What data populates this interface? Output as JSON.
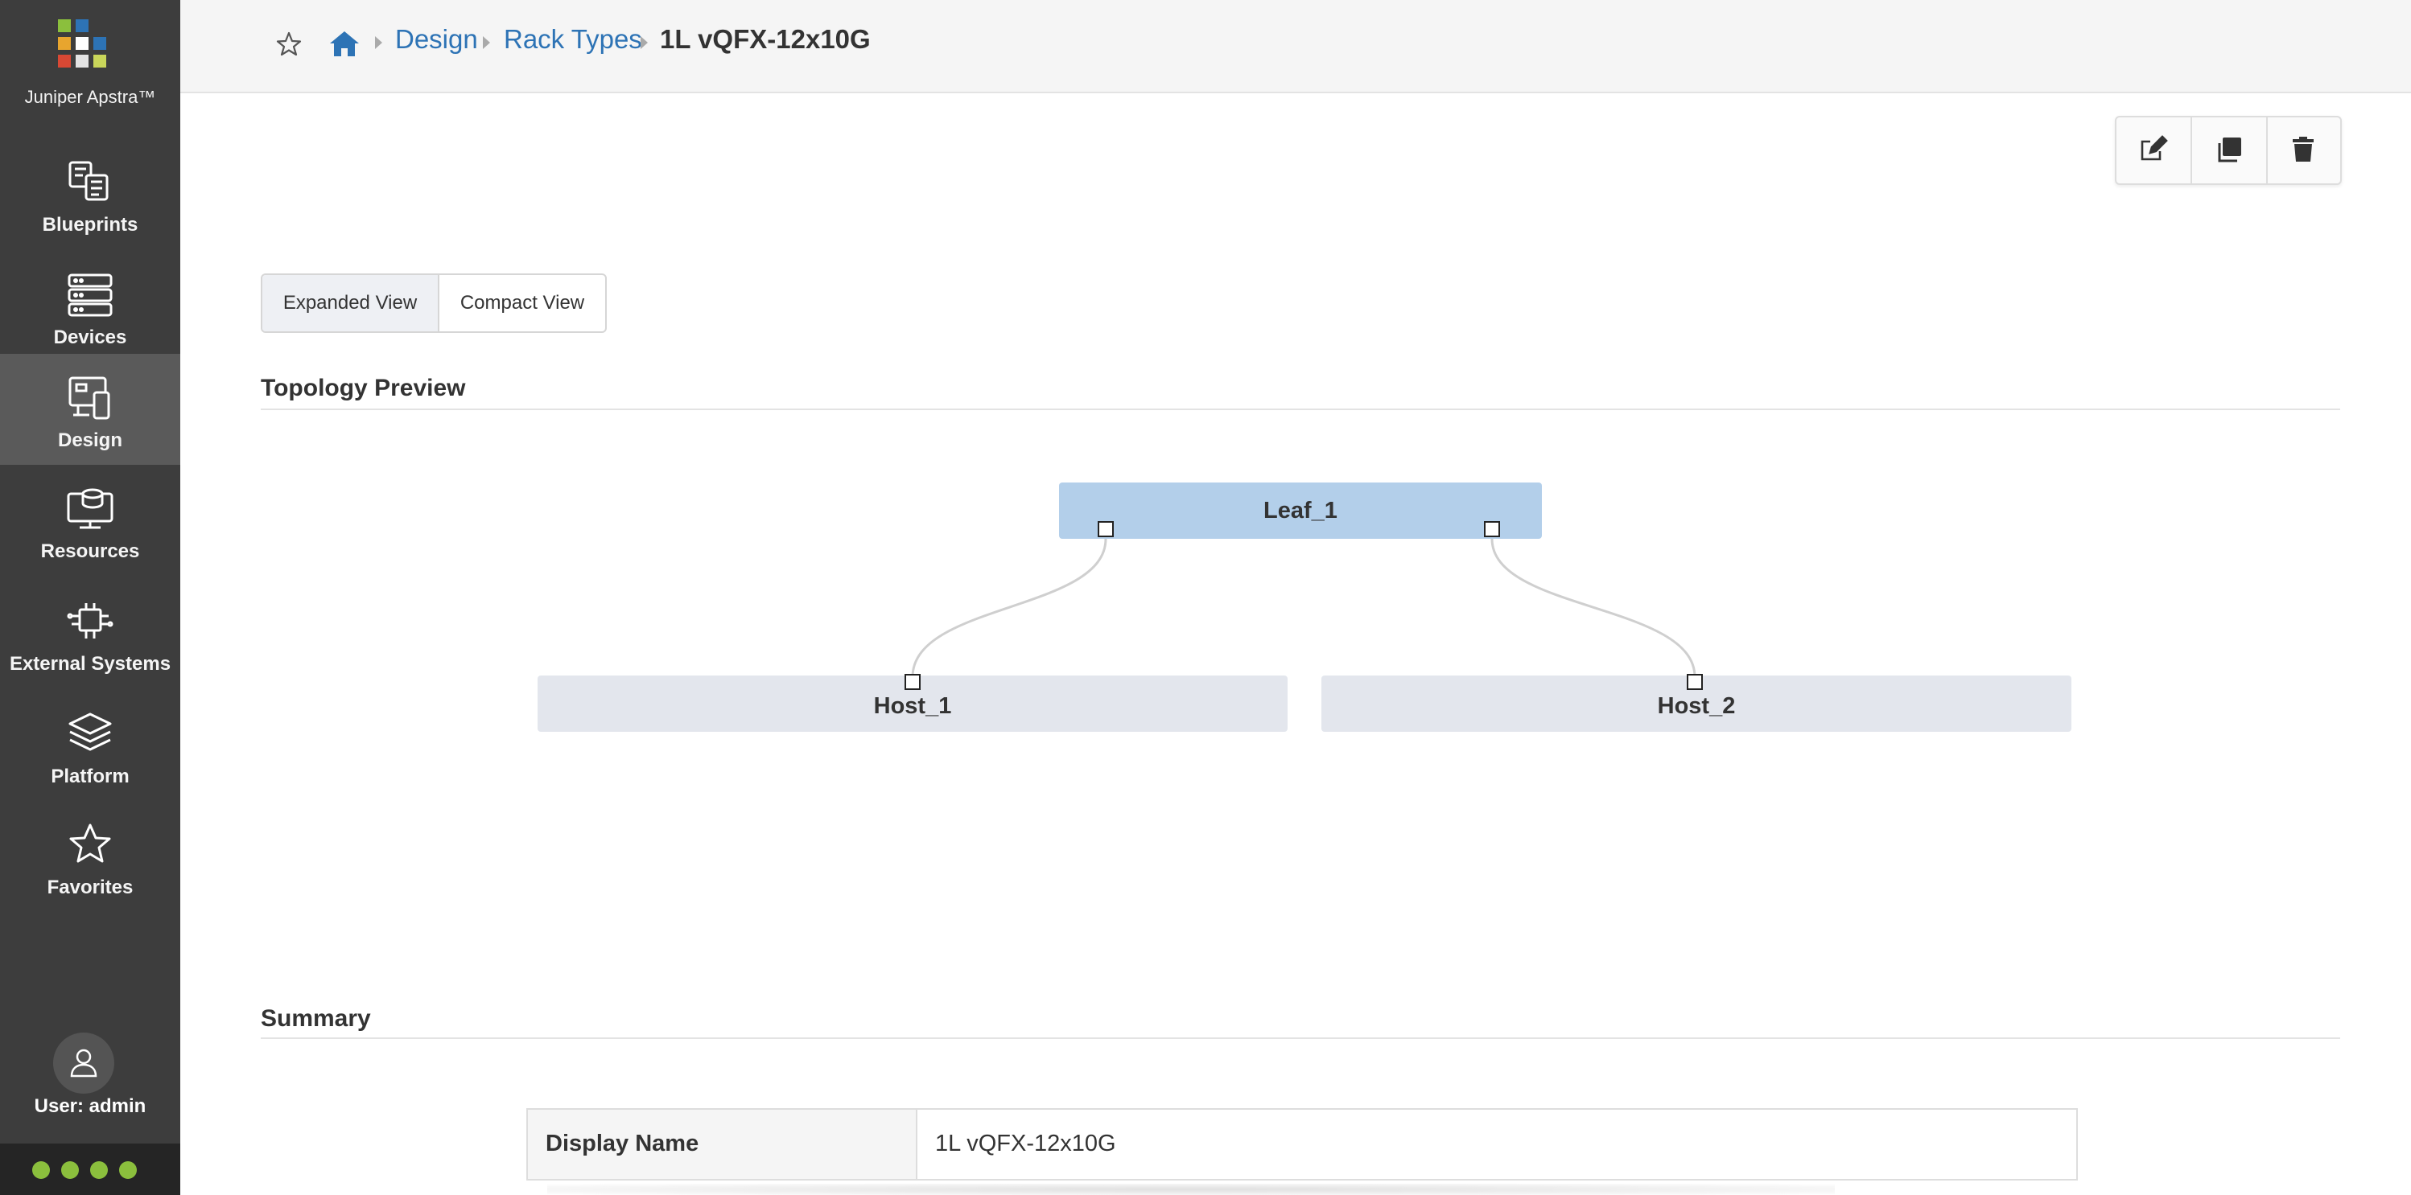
{
  "sidebar": {
    "brand": "Juniper Apstra™",
    "logo_colors": [
      "#8bbf3d",
      "#2d73b5",
      "#e8a52e",
      "#d94834",
      "#2d73b5",
      "#e3e3e3",
      "#d94834",
      "#8bbf3d"
    ],
    "items": [
      {
        "label": "Blueprints",
        "icon": "blueprints-icon"
      },
      {
        "label": "Devices",
        "icon": "devices-icon"
      },
      {
        "label": "Design",
        "icon": "design-icon",
        "active": true
      },
      {
        "label": "Resources",
        "icon": "resources-icon"
      },
      {
        "label": "External Systems",
        "icon": "external-systems-icon"
      },
      {
        "label": "Platform",
        "icon": "platform-icon"
      },
      {
        "label": "Favorites",
        "icon": "star-icon"
      }
    ],
    "user_label": "User: admin",
    "status_color": "#8bbf3d"
  },
  "breadcrumb": {
    "home_icon": "home-icon",
    "items": [
      "Design",
      "Rack Types"
    ],
    "current": "1L vQFX-12x10G"
  },
  "toolbar": {
    "buttons": [
      "edit-icon",
      "clone-icon",
      "delete-icon"
    ]
  },
  "views": {
    "expanded": "Expanded View",
    "compact": "Compact View",
    "active": "expanded"
  },
  "topology": {
    "title": "Topology Preview",
    "leaf": "Leaf_1",
    "hosts": [
      "Host_1",
      "Host_2"
    ],
    "leaf_color": "#b3cfea",
    "host_color": "#e3e6ed"
  },
  "summary": {
    "title": "Summary",
    "rows": [
      {
        "key": "Display Name",
        "value": "1L vQFX-12x10G"
      }
    ]
  }
}
